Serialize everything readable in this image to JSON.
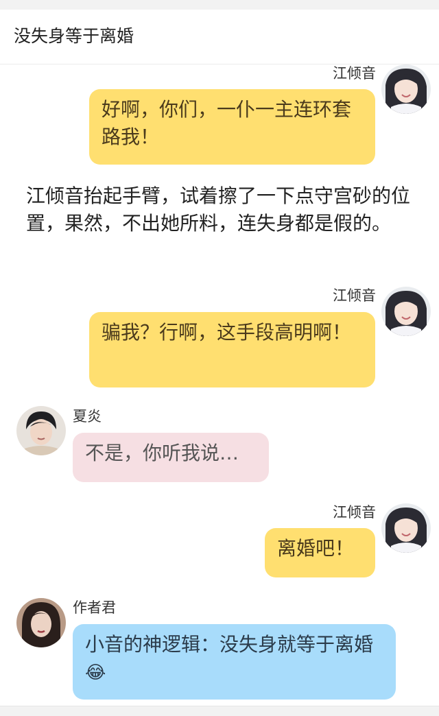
{
  "header": {
    "title": "没失身等于离婚"
  },
  "messages": [
    {
      "speaker": "江倾音",
      "text": "好啊，你们，一仆一主连环套路我！"
    },
    {
      "speaker": "江倾音",
      "text": "骗我？行啊，这手段高明啊！"
    },
    {
      "speaker": "夏炎",
      "text": "不是，你听我说…"
    },
    {
      "speaker": "江倾音",
      "text": "离婚吧！"
    },
    {
      "speaker": "作者君",
      "text": "小音的神逻辑：没失身就等于离婚",
      "emoji": "😂"
    }
  ],
  "narration": "江倾音抬起手臂，试着擦了一下点守宫砂的位置，果然，不出她所料，连失身都是假的。",
  "colors": {
    "bubble_yellow": "#ffdf70",
    "bubble_pink": "#f6dfe3",
    "bubble_blue": "#a8dcfb"
  }
}
